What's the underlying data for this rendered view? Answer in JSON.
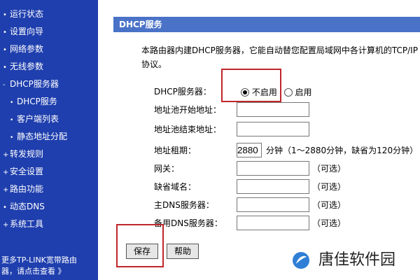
{
  "sidebar": {
    "items": [
      {
        "label": "运行状态",
        "sub": false
      },
      {
        "label": "设置向导",
        "sub": false
      },
      {
        "label": "网络参数",
        "sub": false
      },
      {
        "label": "无线参数",
        "sub": false
      },
      {
        "label": "DHCP服务器",
        "sub": false
      },
      {
        "label": "DHCP服务",
        "sub": true
      },
      {
        "label": "客户端列表",
        "sub": true
      },
      {
        "label": "静态地址分配",
        "sub": true
      },
      {
        "label": "转发规则",
        "sub": false
      },
      {
        "label": "安全设置",
        "sub": false
      },
      {
        "label": "路由功能",
        "sub": false
      },
      {
        "label": "动态DNS",
        "sub": false
      },
      {
        "label": "系统工具",
        "sub": false
      }
    ],
    "footer_line1": "更多TP-LINK宽带路由",
    "footer_line2": "器，请点击查看 》"
  },
  "panel": {
    "title": "DHCP服务",
    "description": "本路由器内建DHCP服务器，它能自动替您配置局域网中各计算机的TCP/IP协议。"
  },
  "form": {
    "server_label": "DHCP服务器：",
    "disable_label": "不启用",
    "enable_label": "启用",
    "pool_start_label": "地址池开始地址：",
    "pool_start_value": "",
    "pool_end_label": "地址池结束地址：",
    "pool_end_value": "",
    "lease_label": "地址租期：",
    "lease_value": "2880",
    "lease_hint": "分钟（1～2880分钟，缺省为120分钟）",
    "gateway_label": "网关：",
    "domain_label": "缺省域名：",
    "dns_primary_label": "主DNS服务器：",
    "dns_backup_label": "备用DNS服务器：",
    "optional_hint": "（可选）"
  },
  "buttons": {
    "save": "保存",
    "help": "帮助"
  },
  "watermark": {
    "text": "唐佳软件园"
  },
  "colors": {
    "sidebar_bg": "#1f3fae",
    "header_bg": "#4a73c8",
    "highlight": "#c0262c"
  }
}
